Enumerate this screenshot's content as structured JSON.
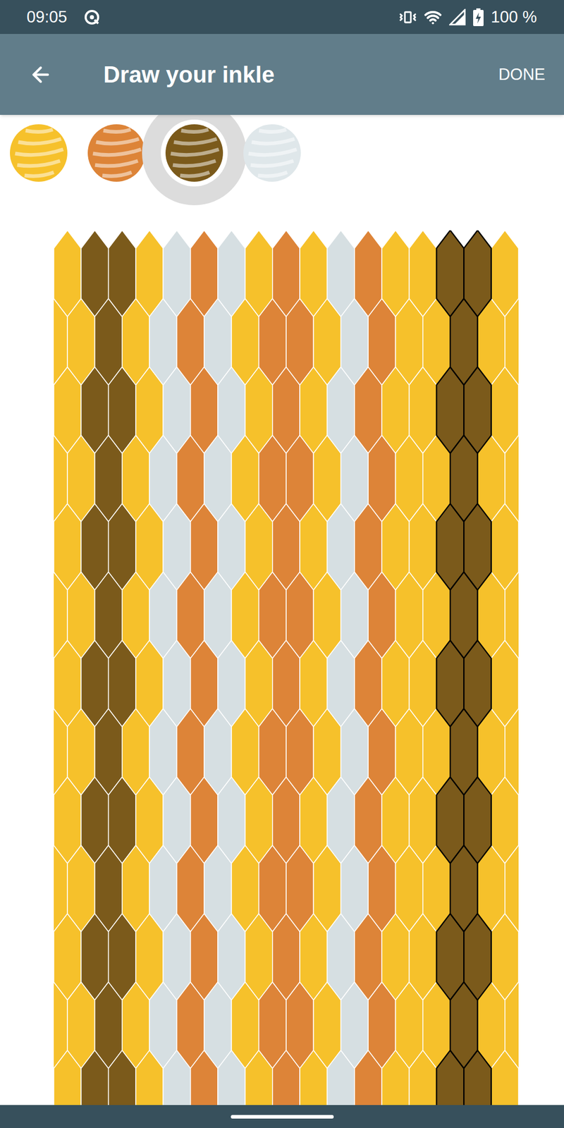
{
  "status_bar": {
    "time": "09:05",
    "battery": "100 %"
  },
  "app_bar": {
    "title": "Draw your inkle",
    "action": "DONE"
  },
  "palette": [
    {
      "color": "#f6c12b",
      "selected": false
    },
    {
      "color": "#dd8438",
      "selected": false
    },
    {
      "color": "#7b5a1b",
      "selected": true
    },
    {
      "color": "#dfe7ea",
      "selected": false
    }
  ],
  "pattern": {
    "threads": [
      {
        "color": "#f6c12b",
        "selected": false
      },
      {
        "color": "#f6c12b",
        "selected": false
      },
      {
        "color": "#f6c12b",
        "selected": false
      },
      {
        "color": "#7b5a1b",
        "selected": false
      },
      {
        "color": "#7b5a1b",
        "selected": false
      },
      {
        "color": "#7b5a1b",
        "selected": false
      },
      {
        "color": "#f6c12b",
        "selected": false
      },
      {
        "color": "#f6c12b",
        "selected": false
      },
      {
        "color": "#d6dfe2",
        "selected": false
      },
      {
        "color": "#d6dfe2",
        "selected": false
      },
      {
        "color": "#dd8438",
        "selected": false
      },
      {
        "color": "#dd8438",
        "selected": false
      },
      {
        "color": "#d6dfe2",
        "selected": false
      },
      {
        "color": "#d6dfe2",
        "selected": false
      },
      {
        "color": "#f6c12b",
        "selected": false
      },
      {
        "color": "#f6c12b",
        "selected": false
      },
      {
        "color": "#dd8438",
        "selected": false
      },
      {
        "color": "#dd8438",
        "selected": false
      },
      {
        "color": "#dd8438",
        "selected": false
      },
      {
        "color": "#f6c12b",
        "selected": false
      },
      {
        "color": "#f6c12b",
        "selected": false
      },
      {
        "color": "#d6dfe2",
        "selected": false
      },
      {
        "color": "#d6dfe2",
        "selected": false
      },
      {
        "color": "#dd8438",
        "selected": false
      },
      {
        "color": "#dd8438",
        "selected": false
      },
      {
        "color": "#f6c12b",
        "selected": false
      },
      {
        "color": "#f6c12b",
        "selected": false
      },
      {
        "color": "#f6c12b",
        "selected": false
      },
      {
        "color": "#f6c12b",
        "selected": false
      },
      {
        "color": "#7b5a1b",
        "selected": true
      },
      {
        "color": "#7b5a1b",
        "selected": true
      },
      {
        "color": "#7b5a1b",
        "selected": true
      },
      {
        "color": "#f6c12b",
        "selected": false
      },
      {
        "color": "#f6c12b",
        "selected": false
      },
      {
        "color": "#f6c12b",
        "selected": false
      }
    ]
  }
}
